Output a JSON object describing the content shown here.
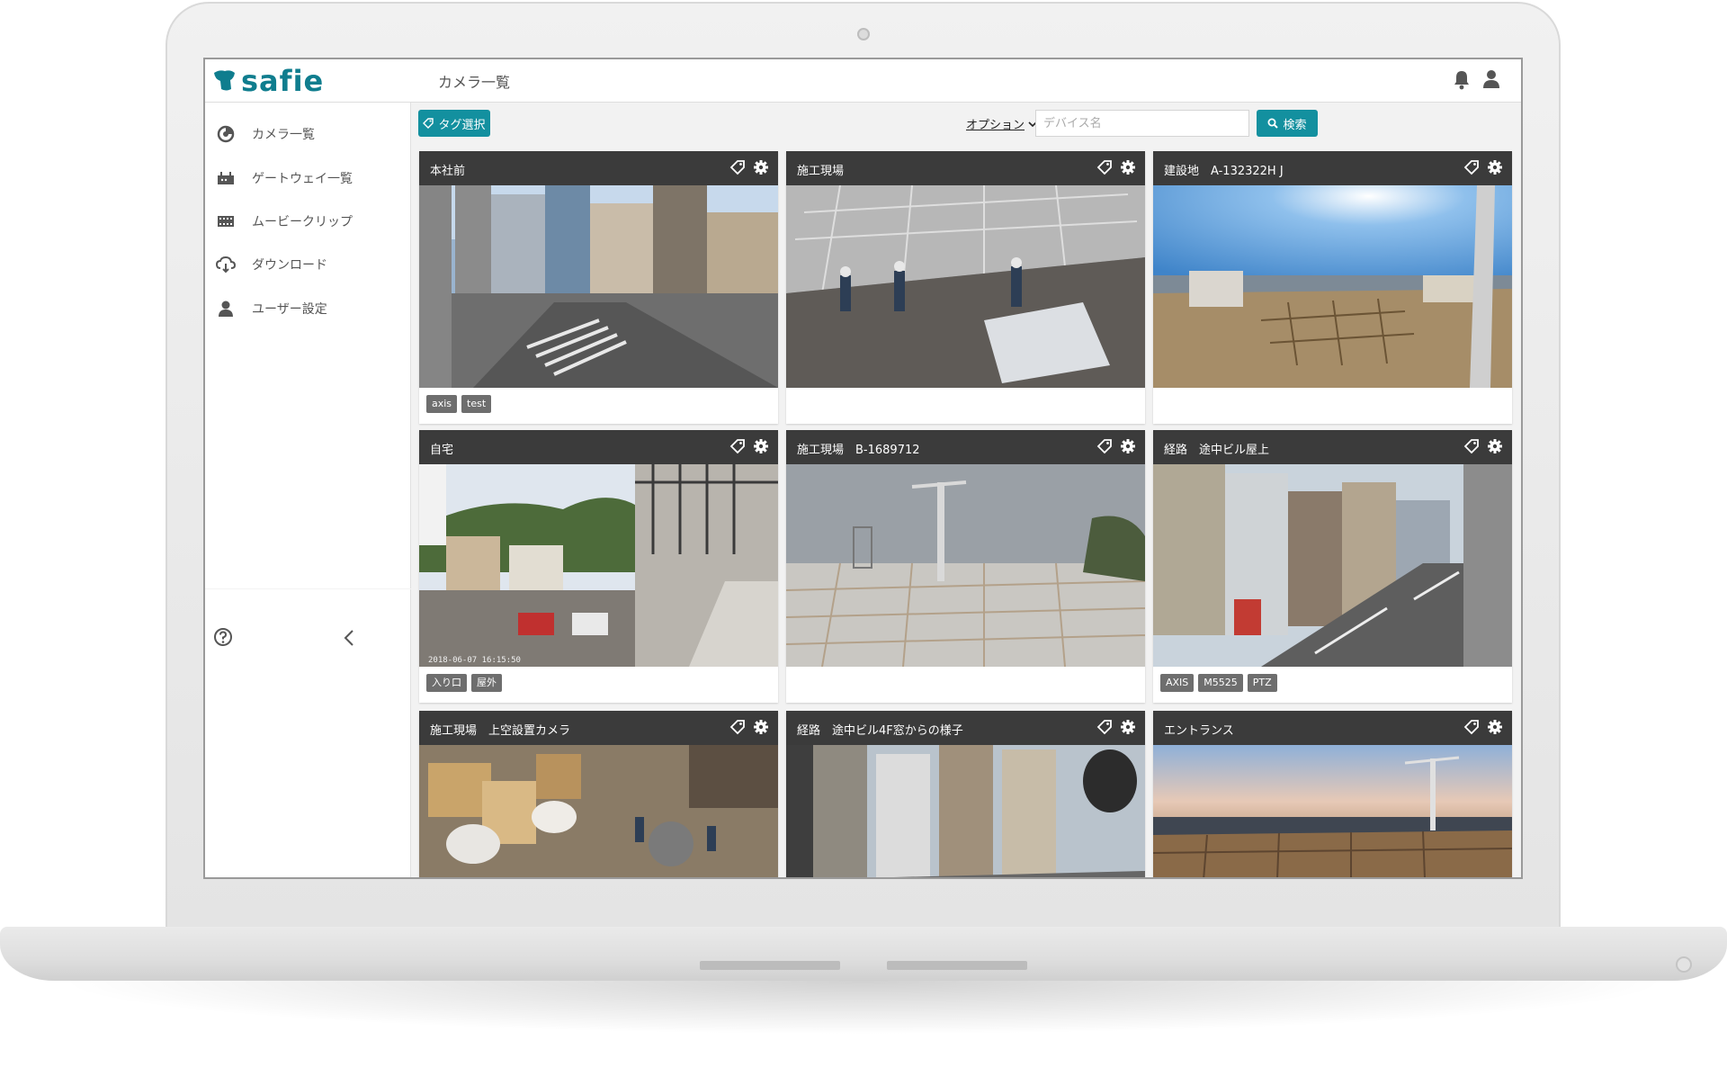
{
  "app": {
    "logo_text": "safie",
    "page_title": "カメラ一覧"
  },
  "header_icons": [
    "bell-icon",
    "user-icon"
  ],
  "sidebar": {
    "items": [
      {
        "label": "カメラ一覧",
        "icon": "camera-icon"
      },
      {
        "label": "ゲートウェイ一覧",
        "icon": "gateway-icon"
      },
      {
        "label": "ムービークリップ",
        "icon": "film-icon"
      },
      {
        "label": "ダウンロード",
        "icon": "cloud-download-icon"
      },
      {
        "label": "ユーザー設定",
        "icon": "user-icon"
      }
    ],
    "help_icon": "help-icon",
    "collapse_icon": "chevron-left-icon"
  },
  "toolbar": {
    "tag_select_label": "タグ選択",
    "option_label": "オプション",
    "device_placeholder": "デバイス名",
    "search_label": "検索"
  },
  "cameras": [
    {
      "title": "本社前",
      "tags": [
        "axis",
        "test"
      ],
      "scene": "street-city",
      "timestamp": ""
    },
    {
      "title": "施工現場",
      "tags": [],
      "scene": "rooftop-workers",
      "timestamp": ""
    },
    {
      "title": "建設地　A-132322H J",
      "tags": [],
      "scene": "construction-wide",
      "timestamp": ""
    },
    {
      "title": "自宅",
      "tags": [
        "入り口",
        "屋外"
      ],
      "scene": "residential-stairs",
      "timestamp": "2018-06-07 16:15:50"
    },
    {
      "title": "施工現場　B-1689712",
      "tags": [],
      "scene": "construction-crane",
      "timestamp": ""
    },
    {
      "title": "経路　途中ビル屋上",
      "tags": [
        "AXIS",
        "M5525",
        "PTZ"
      ],
      "scene": "street-buildings",
      "timestamp": ""
    },
    {
      "title": "施工現場　上空設置カメラ",
      "tags": [],
      "scene": "overhead-debris",
      "timestamp": ""
    },
    {
      "title": "経路　途中ビル4F窓からの様子",
      "tags": [],
      "scene": "street-window",
      "timestamp": ""
    },
    {
      "title": "エントランス",
      "tags": [],
      "scene": "construction-dusk",
      "timestamp": ""
    }
  ],
  "colors": {
    "accent": "#13909f",
    "logo": "#0f7d8e",
    "card_header": "#3b3b3b",
    "tag_bg": "#6e6e6e"
  }
}
